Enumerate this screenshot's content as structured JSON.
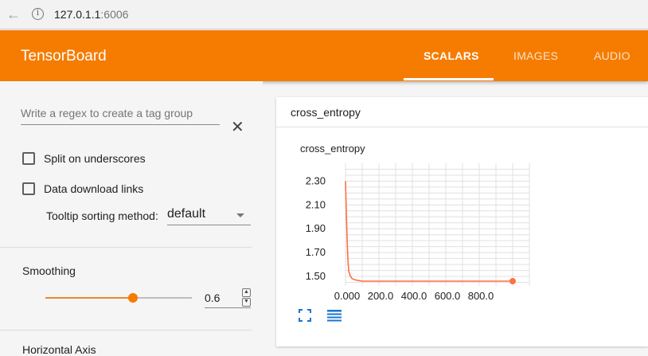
{
  "browser": {
    "url_host": "127.0.1.1",
    "url_port": ":6006"
  },
  "header": {
    "title": "TensorBoard",
    "tabs": [
      {
        "label": "SCALARS",
        "active": true
      },
      {
        "label": "IMAGES",
        "active": false
      },
      {
        "label": "AUDIO",
        "active": false
      }
    ]
  },
  "sidebar": {
    "regex_placeholder": "Write a regex to create a tag group",
    "split_label": "Split on underscores",
    "download_label": "Data download links",
    "tooltip_label": "Tooltip sorting method:",
    "tooltip_value": "default",
    "smoothing_label": "Smoothing",
    "smoothing_value": "0.6",
    "smoothing_fraction": 0.6,
    "horizontal_axis_label": "Horizontal Axis"
  },
  "card": {
    "title": "cross_entropy",
    "chart_title": "cross_entropy"
  },
  "chart_data": {
    "type": "line",
    "title": "cross_entropy",
    "xlabel": "",
    "ylabel": "",
    "x_ticks": [
      "0.000",
      "200.0",
      "400.0",
      "600.0",
      "800.0"
    ],
    "y_ticks": [
      "2.30",
      "2.10",
      "1.90",
      "1.70",
      "1.50"
    ],
    "xlim": [
      0,
      1100
    ],
    "ylim": [
      1.42,
      2.45
    ],
    "grid": true,
    "color": "#ff7043",
    "series": [
      {
        "x": [
          0,
          5,
          10,
          15,
          20,
          30,
          40,
          60,
          80,
          100,
          150,
          200,
          400,
          600,
          800,
          1000
        ],
        "y": [
          2.3,
          2.05,
          1.8,
          1.62,
          1.54,
          1.5,
          1.48,
          1.47,
          1.465,
          1.46,
          1.46,
          1.46,
          1.46,
          1.46,
          1.46,
          1.46
        ]
      }
    ]
  }
}
